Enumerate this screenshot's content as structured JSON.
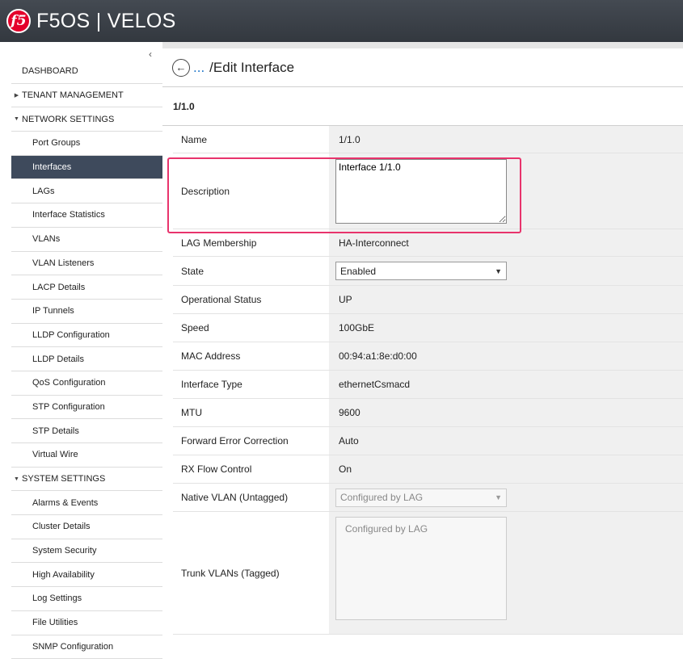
{
  "header": {
    "logo": "f5",
    "title": "F5OS | VELOS"
  },
  "sidebar": {
    "collapse_glyph": "‹",
    "items": [
      {
        "label": "DASHBOARD",
        "kind": "top"
      },
      {
        "label": "TENANT MANAGEMENT",
        "kind": "section",
        "expanded": false
      },
      {
        "label": "NETWORK SETTINGS",
        "kind": "section",
        "expanded": true
      },
      {
        "label": "Port Groups",
        "kind": "sub"
      },
      {
        "label": "Interfaces",
        "kind": "sub",
        "active": true
      },
      {
        "label": "LAGs",
        "kind": "sub"
      },
      {
        "label": "Interface Statistics",
        "kind": "sub"
      },
      {
        "label": "VLANs",
        "kind": "sub"
      },
      {
        "label": "VLAN Listeners",
        "kind": "sub"
      },
      {
        "label": "LACP Details",
        "kind": "sub"
      },
      {
        "label": "IP Tunnels",
        "kind": "sub"
      },
      {
        "label": "LLDP Configuration",
        "kind": "sub"
      },
      {
        "label": "LLDP Details",
        "kind": "sub"
      },
      {
        "label": "QoS Configuration",
        "kind": "sub"
      },
      {
        "label": "STP Configuration",
        "kind": "sub"
      },
      {
        "label": "STP Details",
        "kind": "sub"
      },
      {
        "label": "Virtual Wire",
        "kind": "sub"
      },
      {
        "label": "SYSTEM SETTINGS",
        "kind": "section",
        "expanded": true
      },
      {
        "label": "Alarms & Events",
        "kind": "sub"
      },
      {
        "label": "Cluster Details",
        "kind": "sub"
      },
      {
        "label": "System Security",
        "kind": "sub"
      },
      {
        "label": "High Availability",
        "kind": "sub"
      },
      {
        "label": "Log Settings",
        "kind": "sub"
      },
      {
        "label": "File Utilities",
        "kind": "sub"
      },
      {
        "label": "SNMP Configuration",
        "kind": "sub"
      }
    ]
  },
  "main": {
    "breadcrumb_dots": "...",
    "page_title": "/Edit Interface",
    "interface_heading": "1/1.0",
    "fields": {
      "name": {
        "label": "Name",
        "value": "1/1.0"
      },
      "description": {
        "label": "Description",
        "value": "Interface 1/1.0"
      },
      "lag_membership": {
        "label": "LAG Membership",
        "value": "HA-Interconnect"
      },
      "state": {
        "label": "State",
        "value": "Enabled"
      },
      "operational_status": {
        "label": "Operational Status",
        "value": "UP"
      },
      "speed": {
        "label": "Speed",
        "value": "100GbE"
      },
      "mac_address": {
        "label": "MAC Address",
        "value": "00:94:a1:8e:d0:00"
      },
      "interface_type": {
        "label": "Interface Type",
        "value": "ethernetCsmacd"
      },
      "mtu": {
        "label": "MTU",
        "value": "9600"
      },
      "fec": {
        "label": "Forward Error Correction",
        "value": "Auto"
      },
      "rx_flow_control": {
        "label": "RX Flow Control",
        "value": "On"
      },
      "native_vlan": {
        "label": "Native VLAN (Untagged)",
        "value": "Configured by LAG"
      },
      "trunk_vlans": {
        "label": "Trunk VLANs (Tagged)",
        "value": "Configured by LAG"
      }
    }
  },
  "colors": {
    "header_bg": "#3a3f46",
    "active_nav": "#3e4a5c",
    "highlight": "#e8336c",
    "link": "#1a73c8",
    "logo_red": "#e4002b"
  }
}
